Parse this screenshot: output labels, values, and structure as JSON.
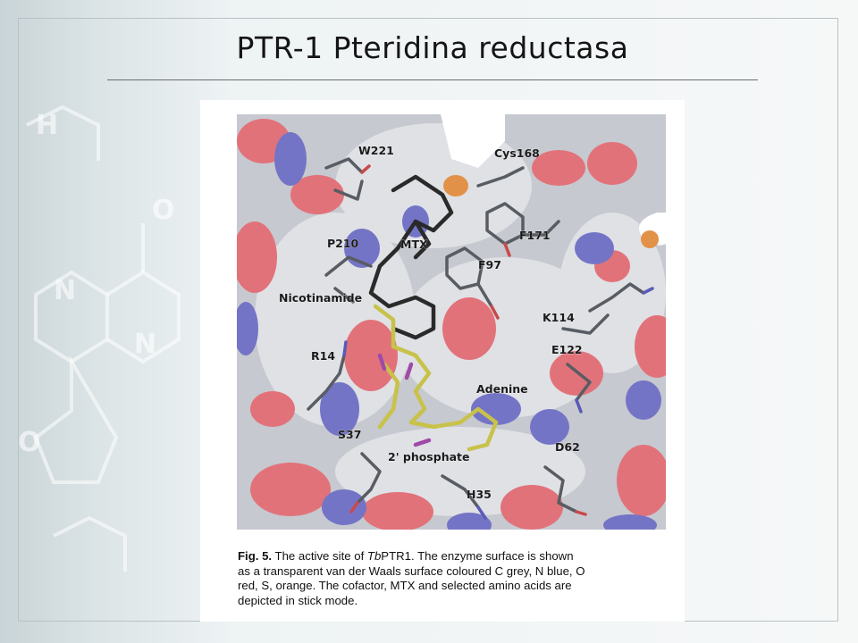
{
  "slide": {
    "title": "PTR-1 Pteridina reductasa"
  },
  "figure": {
    "labels": {
      "w221": "W221",
      "cys168": "Cys168",
      "mtx": "MTX",
      "p210": "P210",
      "f171": "F171",
      "f97": "F97",
      "nicotinamide": "Nicotinamide",
      "k114": "K114",
      "r14": "R14",
      "e122": "E122",
      "adenine": "Adenine",
      "s37": "S37",
      "d62": "D62",
      "phosphate": "2' phosphate",
      "h35": "H35"
    },
    "surface_colors": {
      "carbon": "#c9ccd2",
      "nitrogen": "#7272c8",
      "oxygen": "#e07078",
      "sulfur": "#e0904a"
    },
    "caption": {
      "fig_label": "Fig. 5.",
      "line1_a": "The active site of ",
      "line1_ital": "Tb",
      "line1_b": "PTR1. The enzyme surface is shown",
      "line2": "as a transparent van der Waals surface coloured C grey, N blue, O",
      "line3": "red, S, orange. The cofactor, MTX and selected amino acids are",
      "line4": "depicted in stick mode."
    }
  }
}
